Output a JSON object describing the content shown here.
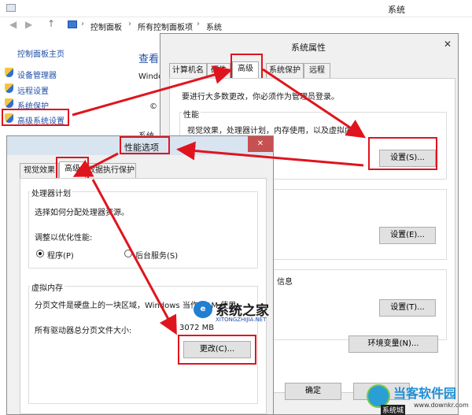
{
  "system_window": {
    "title": "系统",
    "breadcrumb": [
      "控制面板",
      "所有控制面板项",
      "系统"
    ],
    "left_nav": {
      "home": "控制面板主页",
      "items": [
        "设备管理器",
        "远程设置",
        "系统保护",
        "高级系统设置"
      ]
    },
    "main": {
      "heading_partial": "查看",
      "text1": "Windo",
      "text2": "©",
      "text3": "系统"
    }
  },
  "system_properties": {
    "title": "系统属性",
    "tabs": [
      "计算机名",
      "硬件",
      "高级",
      "系统保护",
      "远程"
    ],
    "active_tab": "高级",
    "admin_note": "要进行大多数更改，你必须作为管理员登录。",
    "performance": {
      "title": "性能",
      "description": "视觉效果，处理器计划，内存使用，以及虚拟内存",
      "button": "设置(S)..."
    },
    "profile_button": "设置(E)...",
    "startup_partial": "信息",
    "startup_button": "设置(T)...",
    "env_button": "环境变量(N)...",
    "ok_button": "确定",
    "cancel_partial": "取"
  },
  "performance_options": {
    "title": "性能选项",
    "close_glyph": "✕",
    "tabs": [
      "视觉效果",
      "高级",
      "数据执行保护"
    ],
    "active_tab": "高级",
    "processor": {
      "title": "处理器计划",
      "description": "选择如何分配处理器资源。",
      "adjust_label": "调整以优化性能:",
      "options": [
        "程序(P)",
        "后台服务(S)"
      ],
      "selected": "程序(P)"
    },
    "virtual_memory": {
      "title": "虚拟内存",
      "description": "分页文件是硬盘上的一块区域，Windows 当作 RAM 使用。",
      "total_label": "所有驱动器总分页文件大小:",
      "total_value": "3072 MB",
      "change_button": "更改(C)..."
    }
  },
  "watermarks": {
    "site1_name": "系统之家",
    "site1_url": "XITONGZHIJIA.NET",
    "site2_name": "当客软件园",
    "site2_url": "www.downkr.com",
    "site2_left": "系统城"
  },
  "colors": {
    "annotation_red": "#e0141e",
    "link_blue": "#1f4fa8",
    "window_bg": "#f0f0f0"
  }
}
